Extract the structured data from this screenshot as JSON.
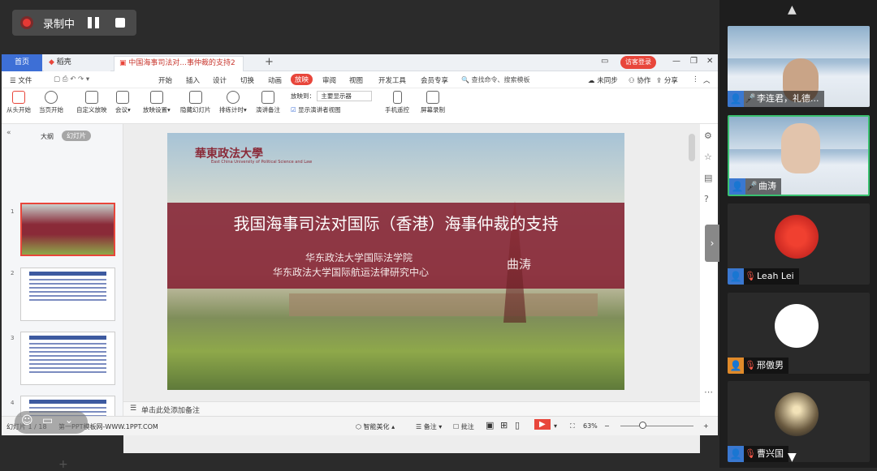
{
  "recording": {
    "label": "录制中"
  },
  "tabs": {
    "home": "首页",
    "daoke": "稻壳",
    "doc": "中国海事司法对...事仲裁的支持2",
    "add": "+"
  },
  "window": {
    "visitor": "访客登录"
  },
  "menu": {
    "file": "文件",
    "items": [
      "开始",
      "插入",
      "设计",
      "切换",
      "动画",
      "放映",
      "审阅",
      "视图",
      "开发工具",
      "会员专享"
    ],
    "search": "查找命令、搜索模板",
    "unsync": "未同步",
    "collab": "协作",
    "share": "分享"
  },
  "ribbon": {
    "from_start": "从头开始",
    "from_current": "当页开始",
    "custom_show": "自定义放映",
    "meeting": "会议",
    "show_settings": "放映设置",
    "hide_slide": "隐藏幻灯片",
    "rehearse": "排练计时",
    "notes": "演讲备注",
    "play_to": "放映到：",
    "display": "主要显示器",
    "presenter_view": "显示演讲者视图",
    "phone_remote": "手机遥控",
    "screen_record": "屏幕录制"
  },
  "sidepane": {
    "outline": "大纲",
    "slides": "幻灯片",
    "slide_numbers": [
      "1",
      "2",
      "3",
      "4"
    ],
    "add": "+"
  },
  "slide": {
    "logo": "華東政法大學",
    "logo_sub": "East China University of Political Science and Law",
    "title": "我国海事司法对国际（香港）海事仲裁的支持",
    "org1": "华东政法大学国际法学院",
    "org2": "华东政法大学国际航运法律研究中心",
    "author": "曲涛"
  },
  "notes": {
    "placeholder": "单击此处添加备注"
  },
  "status": {
    "slide_info": "幻灯片 1 / 18",
    "theme": "第一PPT模板网-WWW.1PPT.COM",
    "beautify": "智能美化",
    "notes": "备注",
    "comments": "批注",
    "zoom": "63%"
  },
  "participants": [
    {
      "name": "李连君，礼德...",
      "mic": "on"
    },
    {
      "name": "曲涛",
      "mic": "on"
    },
    {
      "name": "Leah Lei",
      "mic": "off"
    },
    {
      "name": "邢傲男",
      "mic": "off"
    },
    {
      "name": "曹兴国",
      "mic": "off"
    }
  ],
  "colors": {
    "accent": "#e8463b",
    "slide_band": "#842132",
    "active_border": "#3ac070"
  }
}
